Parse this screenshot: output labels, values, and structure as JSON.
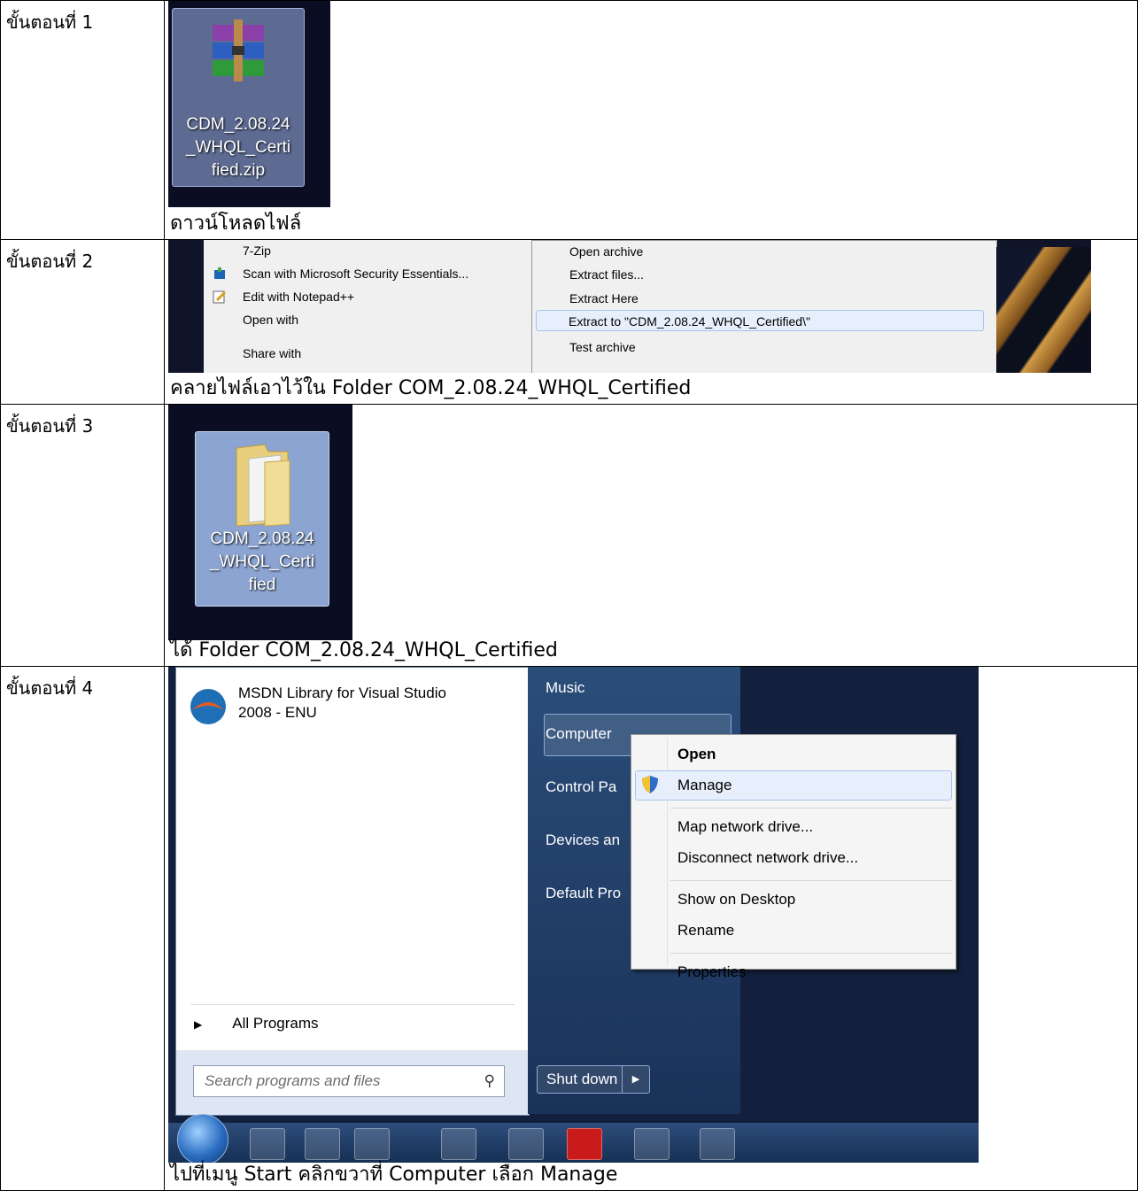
{
  "steps": [
    {
      "label": "ขั้นตอนที่ 1",
      "caption": "ดาวน์โหลดไฟล์",
      "file_icon": {
        "name": "archive-icon",
        "lines": [
          "CDM_2.08.24",
          "_WHQL_Certi",
          "fied.zip"
        ]
      }
    },
    {
      "label": "ขั้นตอนที่ 2",
      "caption": "คลายไฟล์เอาไว้ใน Folder COM_2.08.24_WHQL_Certified",
      "context_menu": [
        "7-Zip",
        "Scan with Microsoft Security Essentials...",
        "Edit with Notepad++",
        "Open with",
        "Share with"
      ],
      "submenu": [
        "Open archive",
        "Extract files...",
        "Extract Here",
        "Extract to \"CDM_2.08.24_WHQL_Certified\\\"",
        "Test archive"
      ]
    },
    {
      "label": "ขั้นตอนที่ 3",
      "caption": "ได้ Folder COM_2.08.24_WHQL_Certified",
      "folder_icon": {
        "name": "folder-icon",
        "lines": [
          "CDM_2.08.24",
          "_WHQL_Certi",
          "fied"
        ]
      }
    },
    {
      "label": "ขั้นตอนที่ 4",
      "caption": "ไปที่เมนู Start คลิกขวาที่ Computer เลือก Manage",
      "start_menu": {
        "program_line1": "MSDN Library for Visual Studio",
        "program_line2": "2008 - ENU",
        "all_programs": "All Programs",
        "search_placeholder": "Search programs and files",
        "right_items": [
          "Music",
          "Computer",
          "Control Pa",
          "Devices an",
          "Default Pro"
        ],
        "shutdown": "Shut down"
      },
      "computer_menu": [
        "Open",
        "Manage",
        "Map network drive...",
        "Disconnect network drive...",
        "Show on Desktop",
        "Rename",
        "Properties"
      ]
    }
  ]
}
